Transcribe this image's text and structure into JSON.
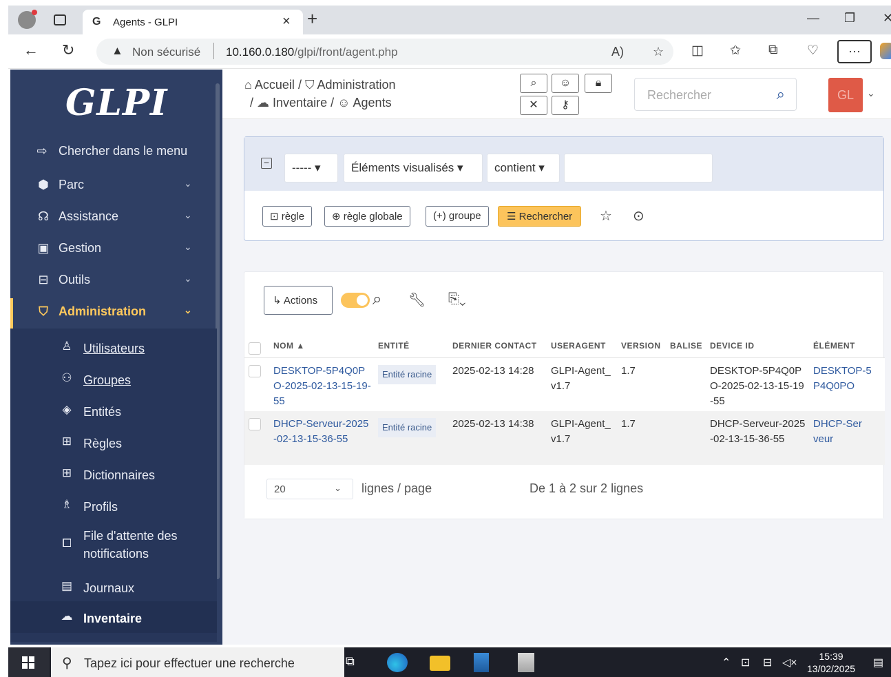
{
  "browser": {
    "tab_title": "Agents - GLPI",
    "tab_favicon": "G",
    "not_secure": "Non sécurisé",
    "url_host": "10.160.0.180",
    "url_path": "/glpi/front/agent.php"
  },
  "sidebar": {
    "logo": "GLPI",
    "menu": [
      {
        "label": "Chercher dans le menu",
        "icon": "arrow-right-icon"
      },
      {
        "label": "Parc",
        "icon": "cube-icon"
      },
      {
        "label": "Assistance",
        "icon": "headset-icon"
      },
      {
        "label": "Gestion",
        "icon": "wallet-icon"
      },
      {
        "label": "Outils",
        "icon": "briefcase-icon"
      },
      {
        "label": "Administration",
        "icon": "shield-icon"
      }
    ],
    "submenu": [
      {
        "label": "Utilisateurs",
        "icon": "user-icon"
      },
      {
        "label": "Groupes",
        "icon": "users-icon"
      },
      {
        "label": "Entités",
        "icon": "stack-icon"
      },
      {
        "label": "Règles",
        "icon": "book-icon"
      },
      {
        "label": "Dictionnaires",
        "icon": "book-icon"
      },
      {
        "label": "Profils",
        "icon": "user-check-icon"
      },
      {
        "label": "File d'attente des notifications",
        "icon": "bell-queue-icon"
      },
      {
        "label": "Journaux",
        "icon": "log-icon"
      },
      {
        "label": "Inventaire",
        "icon": "cloud-upload-icon"
      }
    ]
  },
  "header": {
    "breadcrumb": [
      "Accueil",
      "Administration",
      "Inventaire",
      "Agents"
    ],
    "search_placeholder": "Rechercher",
    "avatar_initials": "GL"
  },
  "criteria": {
    "field_select": "-----",
    "column_select": "Éléments visualisés",
    "operator_select": "contient",
    "value": "",
    "btn_rule": "règle",
    "btn_global_rule": "règle globale",
    "btn_group": "groupe",
    "btn_search": "Rechercher"
  },
  "results": {
    "actions_label": "Actions",
    "columns": [
      "NOM",
      "ENTITÉ",
      "DERNIER CONTACT",
      "USERAGENT",
      "VERSION",
      "BALISE",
      "DEVICE ID",
      "ÉLÉMENT"
    ],
    "rows": [
      {
        "nom": "DESKTOP-5P4Q0PO-2025-02-13-15-19-55",
        "entite": "Entité racine",
        "dernier_contact": "2025-02-13 14:28",
        "useragent": "GLPI-Agent_v1.7",
        "version": "1.7",
        "balise": "",
        "device_id": "DESKTOP-5P4Q0PO-2025-02-13-15-19-55",
        "element": "DESKTOP-5P4Q0PO"
      },
      {
        "nom": "DHCP-Serveur-2025-02-13-15-36-55",
        "entite": "Entité racine",
        "dernier_contact": "2025-02-13 14:38",
        "useragent": "GLPI-Agent_v1.7",
        "version": "1.7",
        "balise": "",
        "device_id": "DHCP-Serveur-2025-02-13-15-36-55",
        "element": "DHCP-Serveur"
      }
    ],
    "per_page": "20",
    "per_page_label": "lignes / page",
    "summary": "De 1 à 2 sur 2 lignes"
  },
  "taskbar": {
    "search_placeholder": "Tapez ici pour effectuer une recherche",
    "time": "15:39",
    "date": "13/02/2025"
  }
}
